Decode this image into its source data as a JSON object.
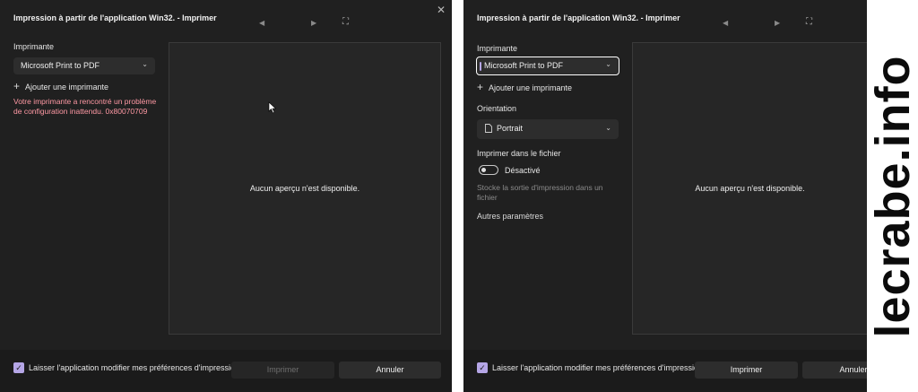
{
  "left_dialog": {
    "title": "Impression à partir de l'application Win32. - Imprimer",
    "close_glyph": "✕",
    "prev_glyph": "◀",
    "next_glyph": "▶",
    "fit_glyph": "⛶",
    "printer_label": "Imprimante",
    "printer_value": "Microsoft Print to PDF",
    "add_printer": "Ajouter une imprimante",
    "error_message": "Votre imprimante a rencontré un problème de configuration inattendu. 0x80070709",
    "preview_message": "Aucun aperçu n'est disponible.",
    "checkbox_label": "Laisser l'application modifier mes préférences d'impression",
    "print_button": "Imprimer",
    "cancel_button": "Annuler"
  },
  "right_dialog": {
    "title": "Impression à partir de l'application Win32. - Imprimer",
    "prev_glyph": "◀",
    "next_glyph": "▶",
    "fit_glyph": "⛶",
    "printer_label": "Imprimante",
    "printer_value": "Microsoft Print to PDF",
    "add_printer": "Ajouter une imprimante",
    "orientation_label": "Orientation",
    "orientation_value": "Portrait",
    "print_to_file_label": "Imprimer dans le fichier",
    "toggle_state": "Désactivé",
    "toggle_description": "Stocke la sortie d'impression dans un fichier",
    "more_settings": "Autres paramètres",
    "preview_message": "Aucun aperçu n'est disponible.",
    "checkbox_label": "Laisser l'application modifier mes préférences d'impression",
    "print_button": "Imprimer",
    "cancel_button": "Annuler"
  },
  "watermark": "lecrabe.info",
  "colors": {
    "background": "#202020",
    "error": "#ff99a4",
    "checkbox_accent": "#b5a6e6",
    "focus_border": "#ffffff"
  }
}
